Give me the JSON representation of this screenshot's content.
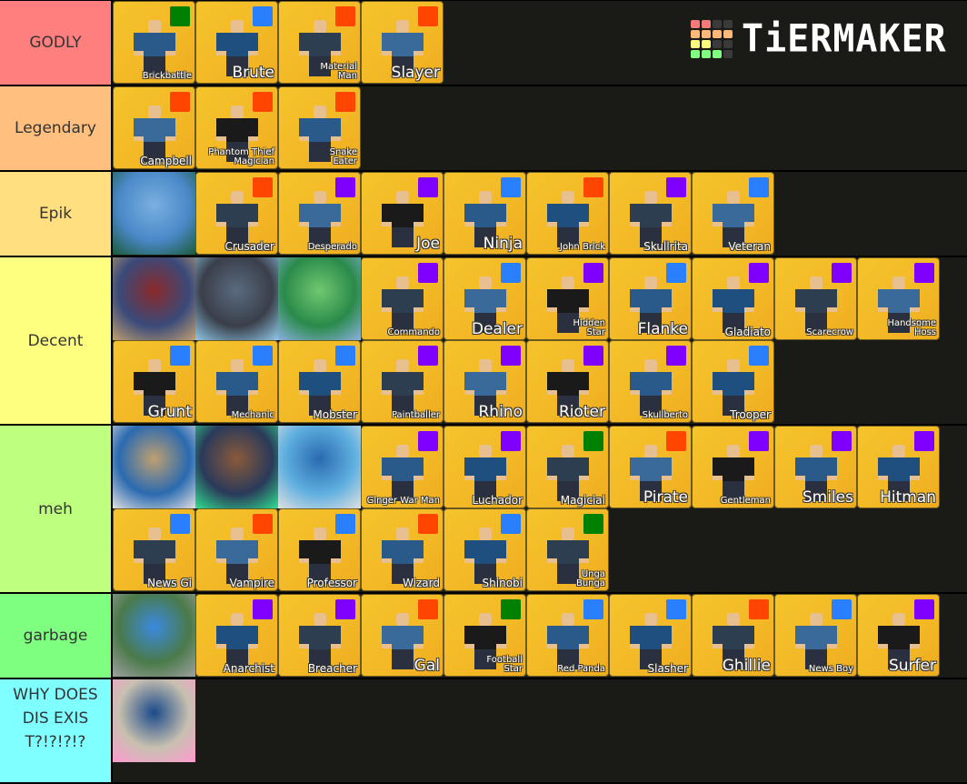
{
  "app": {
    "brand": "TiERMAKER",
    "logo_grid_colors": [
      "#f47a7a",
      "#f47a7a",
      "#3a3a3a",
      "#3a3a3a",
      "#ffb877",
      "#ffb877",
      "#ffb877",
      "#ffb877",
      "#ffff7f",
      "#ffff7f",
      "#3a3a3a",
      "#3a3a3a",
      "#7fff7f",
      "#7fff7f",
      "#7fff7f",
      "#3a3a3a"
    ]
  },
  "rarity_colors": {
    "green": "#008000",
    "blue": "#2a7fff",
    "red": "#ff4500",
    "purple": "#8000ff"
  },
  "tiers": [
    {
      "label": "GODLY",
      "color": "#ff7f7f",
      "items": [
        {
          "name": "Brickbattle",
          "rarity": "green",
          "size": "sm"
        },
        {
          "name": "Brute",
          "rarity": "blue",
          "size": "lg"
        },
        {
          "name": "Material\nMan",
          "rarity": "red",
          "size": "sm"
        },
        {
          "name": "Slayer",
          "rarity": "red",
          "size": "lg"
        }
      ]
    },
    {
      "label": "Legendary",
      "color": "#ffbf7f",
      "items": [
        {
          "name": "Campbell",
          "rarity": "red",
          "size": "md"
        },
        {
          "name": "Phantom Thief\nMagician",
          "rarity": "red",
          "size": "sm"
        },
        {
          "name": "Snake\nEater",
          "rarity": "red",
          "size": "sm"
        }
      ]
    },
    {
      "label": "Epik",
      "color": "#ffdf7f",
      "items": [
        {
          "name": "",
          "photo": true
        },
        {
          "name": "Crusader",
          "rarity": "red",
          "size": "md"
        },
        {
          "name": "Desperado",
          "rarity": "purple",
          "size": "sm"
        },
        {
          "name": "Joe",
          "rarity": "purple",
          "size": "lg"
        },
        {
          "name": "Ninja",
          "rarity": "blue",
          "size": "lg"
        },
        {
          "name": "John Brick",
          "rarity": "red",
          "size": "sm"
        },
        {
          "name": "Skullrita",
          "rarity": "purple",
          "size": "md"
        },
        {
          "name": "Veteran",
          "rarity": "blue",
          "size": "md"
        }
      ]
    },
    {
      "label": "Decent",
      "color": "#ffff7f",
      "items": [
        {
          "name": "",
          "photo": true
        },
        {
          "name": "",
          "photo": true
        },
        {
          "name": "",
          "photo": true
        },
        {
          "name": "Commando",
          "rarity": "purple",
          "size": "sm"
        },
        {
          "name": "Dealer",
          "rarity": "blue",
          "size": "lg"
        },
        {
          "name": "Hidden\nStar",
          "rarity": "purple",
          "size": "sm"
        },
        {
          "name": "Flanke",
          "rarity": "blue",
          "size": "lg"
        },
        {
          "name": "Gladiato",
          "rarity": "purple",
          "size": "md"
        },
        {
          "name": "Scarecrow",
          "rarity": "purple",
          "size": "sm"
        },
        {
          "name": "Handsome\nHoss",
          "rarity": "purple",
          "size": "sm"
        },
        {
          "name": "Grunt",
          "rarity": "blue",
          "size": "lg"
        },
        {
          "name": "Mechanic",
          "rarity": "blue",
          "size": "sm"
        },
        {
          "name": "Mobster",
          "rarity": "blue",
          "size": "md"
        },
        {
          "name": "Paintballer",
          "rarity": "purple",
          "size": "sm"
        },
        {
          "name": "Rhino",
          "rarity": "purple",
          "size": "lg"
        },
        {
          "name": "Rioter",
          "rarity": "purple",
          "size": "lg"
        },
        {
          "name": "Skullberto",
          "rarity": "purple",
          "size": "sm"
        },
        {
          "name": "Trooper",
          "rarity": "blue",
          "size": "md"
        }
      ]
    },
    {
      "label": "meh",
      "color": "#bfff7f",
      "items": [
        {
          "name": "",
          "photo": true
        },
        {
          "name": "",
          "photo": true
        },
        {
          "name": "",
          "photo": true
        },
        {
          "name": "Ginger War Man",
          "rarity": "purple",
          "size": "sm"
        },
        {
          "name": "Luchador",
          "rarity": "purple",
          "size": "md"
        },
        {
          "name": "Magicial",
          "rarity": "green",
          "size": "md"
        },
        {
          "name": "Pirate",
          "rarity": "red",
          "size": "lg"
        },
        {
          "name": "Gentleman",
          "rarity": "purple",
          "size": "sm"
        },
        {
          "name": "Smiles",
          "rarity": "purple",
          "size": "lg"
        },
        {
          "name": "Hitman",
          "rarity": "purple",
          "size": "lg"
        },
        {
          "name": "News Gi",
          "rarity": "blue",
          "size": "md"
        },
        {
          "name": "Vampire",
          "rarity": "red",
          "size": "md"
        },
        {
          "name": "Professor",
          "rarity": "blue",
          "size": "md"
        },
        {
          "name": "Wizard",
          "rarity": "red",
          "size": "md"
        },
        {
          "name": "Shinobi",
          "rarity": "blue",
          "size": "md"
        },
        {
          "name": "Unga\nBunga",
          "rarity": "green",
          "size": "sm"
        }
      ]
    },
    {
      "label": "garbage",
      "color": "#7fff7f",
      "items": [
        {
          "name": "",
          "photo": true
        },
        {
          "name": "Anarchist",
          "rarity": "purple",
          "size": "md"
        },
        {
          "name": "Breacher",
          "rarity": "purple",
          "size": "md"
        },
        {
          "name": "Gal",
          "rarity": "red",
          "size": "lg"
        },
        {
          "name": "Football\nStar",
          "rarity": "green",
          "size": "sm"
        },
        {
          "name": "Red Panda",
          "rarity": "blue",
          "size": "sm"
        },
        {
          "name": "Slasher",
          "rarity": "blue",
          "size": "md"
        },
        {
          "name": "Ghillie",
          "rarity": "red",
          "size": "lg"
        },
        {
          "name": "News Boy",
          "rarity": "blue",
          "size": "sm"
        },
        {
          "name": "Surfer",
          "rarity": "purple",
          "size": "lg"
        }
      ]
    },
    {
      "label": "WHY DOES DIS EXIS T?!?!?!?",
      "color": "#7fffff",
      "items": [
        {
          "name": "",
          "photo": true
        }
      ]
    }
  ]
}
